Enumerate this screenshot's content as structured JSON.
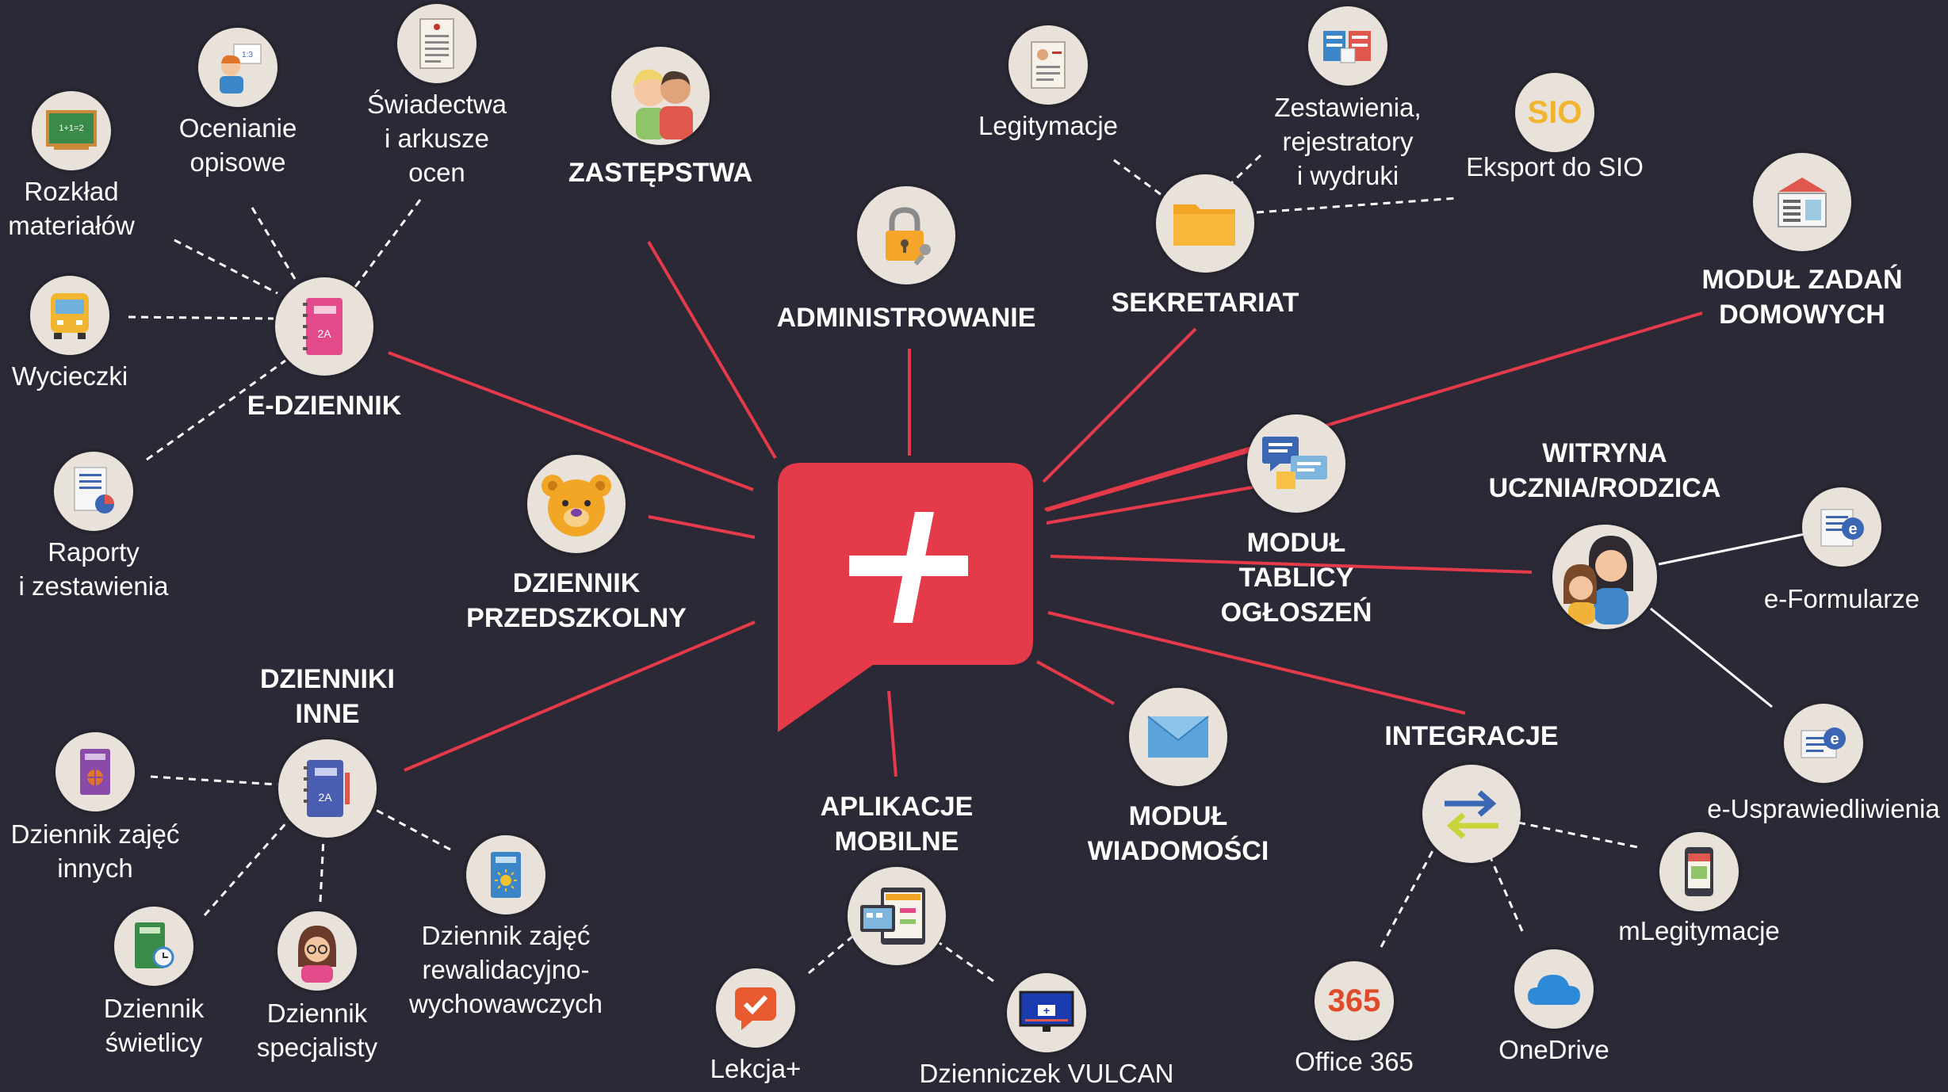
{
  "center": {
    "symbol": "+",
    "color": "#e53a4a"
  },
  "colors": {
    "background": "#2b2936",
    "connector": "#e53a4a",
    "dashed": "#ffffff",
    "circle": "#e8e2da"
  },
  "main_nodes": {
    "e_dziennik": {
      "label": "E-DZIENNIK",
      "icon": "pink-notebook-icon"
    },
    "zastepstwa": {
      "label": "ZASTĘPSTWA",
      "icon": "people-icon"
    },
    "administrowanie": {
      "label": "ADMINISTROWANIE",
      "icon": "padlock-icon"
    },
    "sekretariat": {
      "label": "SEKRETARIAT",
      "icon": "folder-icon"
    },
    "modul_zadan": {
      "label": "MODUŁ ZADAŃ\nDOMOWYCH",
      "icon": "newspaper-icon"
    },
    "tablica": {
      "label": "MODUŁ\nTABLICY\nOGŁOSZEŃ",
      "icon": "chat-board-icon"
    },
    "witryna": {
      "label": "WITRYNA\nUCZNIA/RODZICA",
      "icon": "mother-child-icon"
    },
    "przedszkolny": {
      "label": "DZIENNIK\nPRZEDSZKOLNY",
      "icon": "teddy-bear-icon"
    },
    "inne": {
      "label": "DZIENNIKI\nINNE",
      "icon": "blue-notebook-icon"
    },
    "mobilne": {
      "label": "APLIKACJE\nMOBILNE",
      "icon": "devices-icon"
    },
    "wiadomosci": {
      "label": "MODUŁ\nWIADOMOŚCI",
      "icon": "envelope-icon"
    },
    "integracje": {
      "label": "INTEGRACJE",
      "icon": "arrows-exchange-icon"
    }
  },
  "sub_nodes": {
    "rozklad": {
      "label": "Rozkład\nmateriałów",
      "icon": "chalkboard-icon"
    },
    "ocenianie": {
      "label": "Ocenianie\nopisowe",
      "icon": "student-icon"
    },
    "swiadectwa": {
      "label": "Świadectwa\ni arkusze\nocen",
      "icon": "certificate-icon"
    },
    "wycieczki": {
      "label": "Wycieczki",
      "icon": "bus-icon"
    },
    "raporty": {
      "label": "Raporty\ni zestawienia",
      "icon": "report-icon"
    },
    "legitymacje": {
      "label": "Legitymacje",
      "icon": "id-card-icon"
    },
    "zestawienia": {
      "label": "Zestawienia,\nrejestratory\ni wydruki",
      "icon": "printouts-icon"
    },
    "sio": {
      "label": "Eksport do SIO",
      "icon": "sio-icon",
      "badge": "SIO"
    },
    "eformularze": {
      "label": "e-Formularze",
      "icon": "eforms-icon"
    },
    "eusprawiedliwienia": {
      "label": "e-Usprawiedliwienia",
      "icon": "eexcuse-icon"
    },
    "mlegitymacje": {
      "label": "mLegitymacje",
      "icon": "phone-id-icon"
    },
    "office365": {
      "label": "Office 365",
      "icon": "office365-icon",
      "badge": "365"
    },
    "onedrive": {
      "label": "OneDrive",
      "icon": "cloud-icon"
    },
    "lekcja": {
      "label": "Lekcja+",
      "icon": "check-chat-icon"
    },
    "dzienniczek": {
      "label": "Dzienniczek VULCAN",
      "icon": "monitor-plus-icon"
    },
    "zajec_innych": {
      "label": "Dziennik zajęć\ninnych",
      "icon": "purple-book-icon"
    },
    "swietlicy": {
      "label": "Dziennik\nświetlicy",
      "icon": "green-book-icon"
    },
    "specjalisty": {
      "label": "Dziennik\nspecjalisty",
      "icon": "woman-glasses-icon"
    },
    "rewalidacyjno": {
      "label": "Dziennik zajęć\nrewalidacyjno-\nwychowawczych",
      "icon": "sun-book-icon"
    }
  }
}
